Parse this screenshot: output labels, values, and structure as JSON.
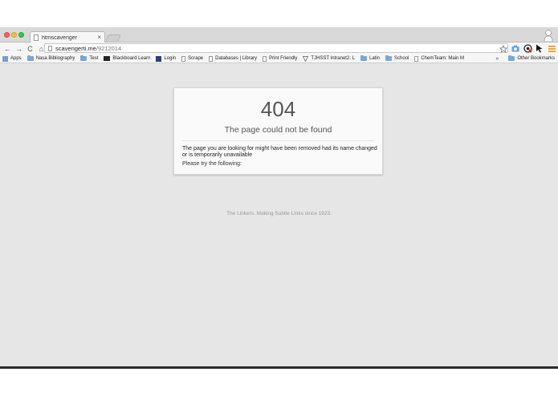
{
  "tab": {
    "title": "htmscavenger",
    "close": "×"
  },
  "toolbar": {
    "back": "←",
    "forward": "→",
    "reload": "C",
    "home": "⌂",
    "url_host": "scavengerti.me",
    "url_path": "/9212014"
  },
  "bookmarks": {
    "items": [
      {
        "label": "Apps"
      },
      {
        "label": "Nasa Bibliography"
      },
      {
        "label": "Test"
      },
      {
        "label": "Blackboard Learn"
      },
      {
        "label": "Login"
      },
      {
        "label": "Scrape"
      },
      {
        "label": "Databases | Library"
      },
      {
        "label": "Print Friendly"
      },
      {
        "label": "TJHSST Intranet2: L"
      },
      {
        "label": "Latin"
      },
      {
        "label": "School"
      },
      {
        "label": "ChemTeam: Main M"
      }
    ],
    "more": "»",
    "other": "Other Bookmarks"
  },
  "error": {
    "code": "404",
    "title": "The page could not be found",
    "message": "The page you are looking for might have been removed had its name changed or is temporarily unavailable",
    "try": "Please try the following:"
  },
  "footer": {
    "text": "The Linkers. Making Subtle Links since 1923."
  },
  "colors": {
    "window_bg": "#e6e6e6",
    "card_bg": "#fafafa",
    "text_muted": "#555555"
  }
}
